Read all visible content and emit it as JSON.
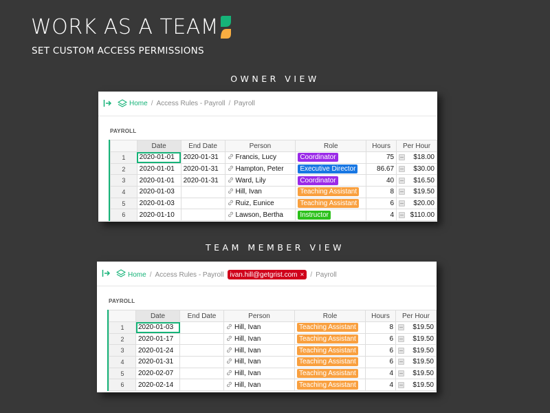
{
  "hero": {
    "title": "WORK AS A TEAM",
    "subtitle": "SET CUSTOM ACCESS PERMISSIONS"
  },
  "brand_colors": {
    "green": "#16b378",
    "yellow": "#f9ae41"
  },
  "role_colors": {
    "Coordinator": "#9b2ae8",
    "Executive Director": "#1877e3",
    "Teaching Assistant": "#f9a03f",
    "Instructor": "#2cc11b"
  },
  "columns": [
    "Date",
    "End Date",
    "Person",
    "Role",
    "Hours",
    "Per Hour"
  ],
  "owner": {
    "label": "OWNER VIEW",
    "breadcrumb": {
      "home": "Home",
      "page": "Access Rules - Payroll",
      "current": "Payroll"
    },
    "section": "PAYROLL",
    "rows": [
      {
        "n": "1",
        "date": "2020-01-01",
        "end": "2020-01-31",
        "person": "Francis, Lucy",
        "role": "Coordinator",
        "hours": "75",
        "rate": "$18.00"
      },
      {
        "n": "2",
        "date": "2020-01-01",
        "end": "2020-01-31",
        "person": "Hampton, Peter",
        "role": "Executive Director",
        "hours": "86.67",
        "rate": "$30.00"
      },
      {
        "n": "3",
        "date": "2020-01-01",
        "end": "2020-01-31",
        "person": "Ward, Lily",
        "role": "Coordinator",
        "hours": "40",
        "rate": "$16.50"
      },
      {
        "n": "4",
        "date": "2020-01-03",
        "end": "",
        "person": "Hill, Ivan",
        "role": "Teaching Assistant",
        "hours": "8",
        "rate": "$19.50"
      },
      {
        "n": "5",
        "date": "2020-01-03",
        "end": "",
        "person": "Ruiz, Eunice",
        "role": "Teaching Assistant",
        "hours": "6",
        "rate": "$20.00"
      },
      {
        "n": "6",
        "date": "2020-01-10",
        "end": "",
        "person": "Lawson, Bertha",
        "role": "Instructor",
        "hours": "4",
        "rate": "$110.00"
      }
    ]
  },
  "member": {
    "label": "TEAM MEMBER VIEW",
    "breadcrumb": {
      "home": "Home",
      "page": "Access Rules - Payroll",
      "user": "ivan.hill@getgrist.com",
      "user_close": "×",
      "current": "Payroll"
    },
    "section": "PAYROLL",
    "rows": [
      {
        "n": "1",
        "date": "2020-01-03",
        "end": "",
        "person": "Hill, Ivan",
        "role": "Teaching Assistant",
        "hours": "8",
        "rate": "$19.50"
      },
      {
        "n": "2",
        "date": "2020-01-17",
        "end": "",
        "person": "Hill, Ivan",
        "role": "Teaching Assistant",
        "hours": "6",
        "rate": "$19.50"
      },
      {
        "n": "3",
        "date": "2020-01-24",
        "end": "",
        "person": "Hill, Ivan",
        "role": "Teaching Assistant",
        "hours": "6",
        "rate": "$19.50"
      },
      {
        "n": "4",
        "date": "2020-01-31",
        "end": "",
        "person": "Hill, Ivan",
        "role": "Teaching Assistant",
        "hours": "6",
        "rate": "$19.50"
      },
      {
        "n": "5",
        "date": "2020-02-07",
        "end": "",
        "person": "Hill, Ivan",
        "role": "Teaching Assistant",
        "hours": "4",
        "rate": "$19.50"
      },
      {
        "n": "6",
        "date": "2020-02-14",
        "end": "",
        "person": "Hill, Ivan",
        "role": "Teaching Assistant",
        "hours": "4",
        "rate": "$19.50"
      }
    ]
  }
}
